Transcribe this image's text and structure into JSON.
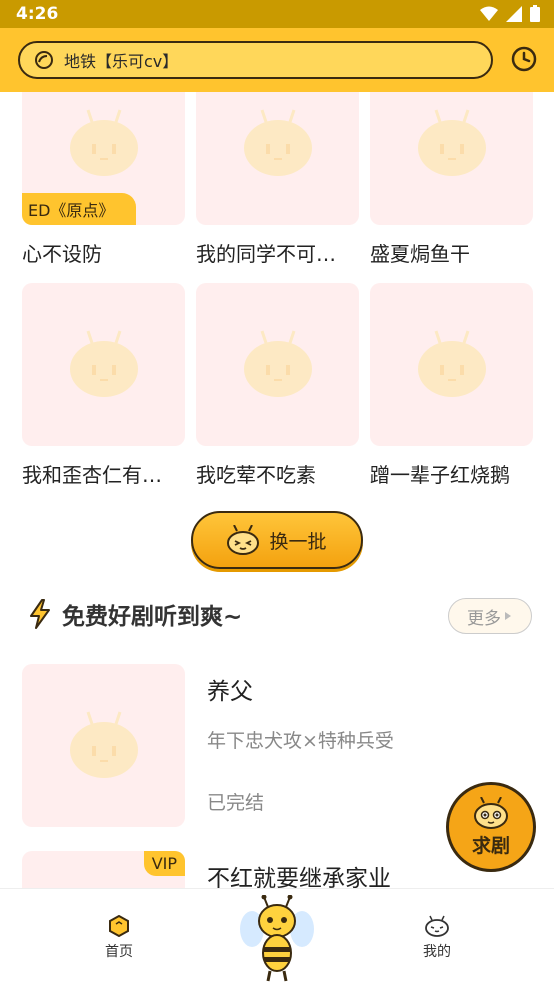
{
  "status_bar": {
    "time": "4:26"
  },
  "search": {
    "placeholder": "地铁【乐可cv】"
  },
  "grid": [
    {
      "title": "心不设防",
      "tag": "ED《原点》"
    },
    {
      "title": "我的同学不可…",
      "tag": ""
    },
    {
      "title": "盛夏焗鱼干",
      "tag": ""
    },
    {
      "title": "我和歪杏仁有…",
      "tag": ""
    },
    {
      "title": "我吃荤不吃素",
      "tag": ""
    },
    {
      "title": "蹭一辈子红烧鹅",
      "tag": ""
    }
  ],
  "swap_button": {
    "label": "换一批"
  },
  "section": {
    "title": "免费好剧听到爽~",
    "more_label": "更多"
  },
  "list": [
    {
      "title": "养父",
      "desc": "年下忠犬攻×特种兵受",
      "status": "已完结",
      "vip": ""
    },
    {
      "title": "不红就要继承家业",
      "desc": "",
      "status": "",
      "vip": "VIP"
    }
  ],
  "fab": {
    "label": "求剧"
  },
  "tabbar": {
    "home": "首页",
    "mine": "我的"
  },
  "colors": {
    "brand": "#ffc42e",
    "status_bar": "#c99a00",
    "cover_placeholder": "#ffeeee"
  }
}
